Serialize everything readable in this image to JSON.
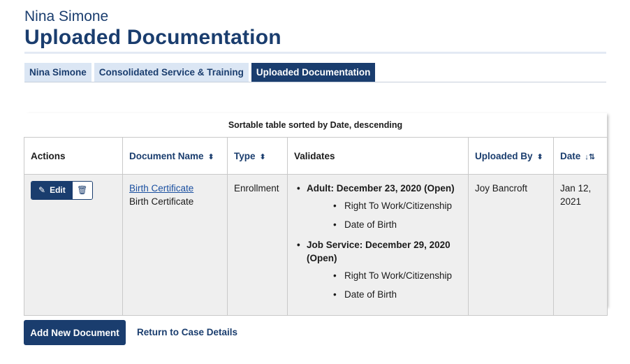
{
  "header": {
    "person_name": "Nina Simone",
    "page_title": "Uploaded Documentation"
  },
  "tabs": [
    {
      "label": "Nina Simone",
      "active": false
    },
    {
      "label": "Consolidated Service & Training",
      "active": false
    },
    {
      "label": "Uploaded Documentation",
      "active": true
    }
  ],
  "table": {
    "caption": "Sortable table sorted by Date, descending",
    "columns": {
      "actions": "Actions",
      "document_name": "Document Name",
      "type": "Type",
      "validates": "Validates",
      "uploaded_by": "Uploaded By",
      "date": "Date"
    },
    "rows": [
      {
        "edit_label": "Edit",
        "doc_link": "Birth Certificate",
        "doc_name": "Birth Certificate",
        "type": "Enrollment",
        "validates": [
          {
            "label": "Adult: December 23, 2020 (Open)",
            "items": [
              "Right To Work/Citizenship",
              "Date of Birth"
            ]
          },
          {
            "label": "Job Service: December 29, 2020 (Open)",
            "items": [
              "Right To Work/Citizenship",
              "Date of Birth"
            ]
          }
        ],
        "uploaded_by": "Joy Bancroft",
        "date": "Jan 12, 2021"
      }
    ]
  },
  "actions": {
    "add_new": "Add New Document",
    "return_link": "Return to Case Details"
  },
  "colors": {
    "primary": "#1a3d6e",
    "tab_inactive_bg": "#dbe6f4",
    "row_bg": "#efefef"
  }
}
